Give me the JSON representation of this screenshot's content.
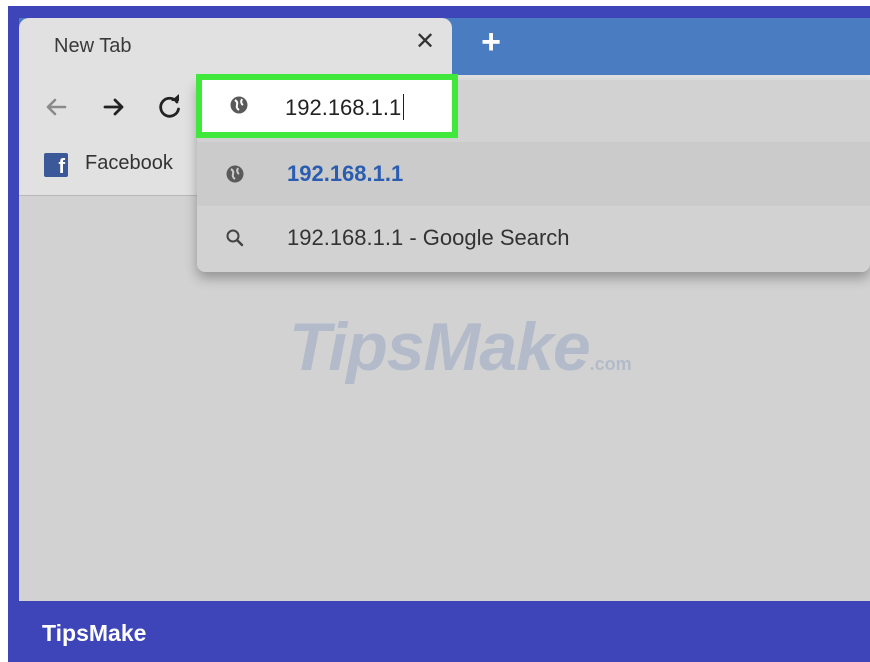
{
  "tab": {
    "title": "New Tab",
    "close_glyph": "✕",
    "new_tab_glyph": "+"
  },
  "toolbar": {
    "back_icon": "arrow-left-icon",
    "forward_icon": "arrow-right-icon",
    "reload_icon": "reload-icon"
  },
  "omnibox": {
    "value": "192.168.1.1",
    "icon": "globe-icon"
  },
  "bookmarks": [
    {
      "label": "Facebook",
      "icon": "facebook-icon",
      "icon_glyph": "f"
    }
  ],
  "suggestions": [
    {
      "text": "192.168.1.1",
      "icon": "globe-icon"
    },
    {
      "text": "192.168.1.1 - Google Search",
      "icon": "search-icon"
    }
  ],
  "watermark": {
    "text": "TipsMake",
    "suffix": ".com"
  },
  "footer": {
    "brand": "TipsMake"
  },
  "colors": {
    "frame": "#3e45b8",
    "tabstrip": "#4a7cc2",
    "highlight": "#3fe83a",
    "suggestion_link": "#2a5db0",
    "facebook": "#3b5998"
  }
}
